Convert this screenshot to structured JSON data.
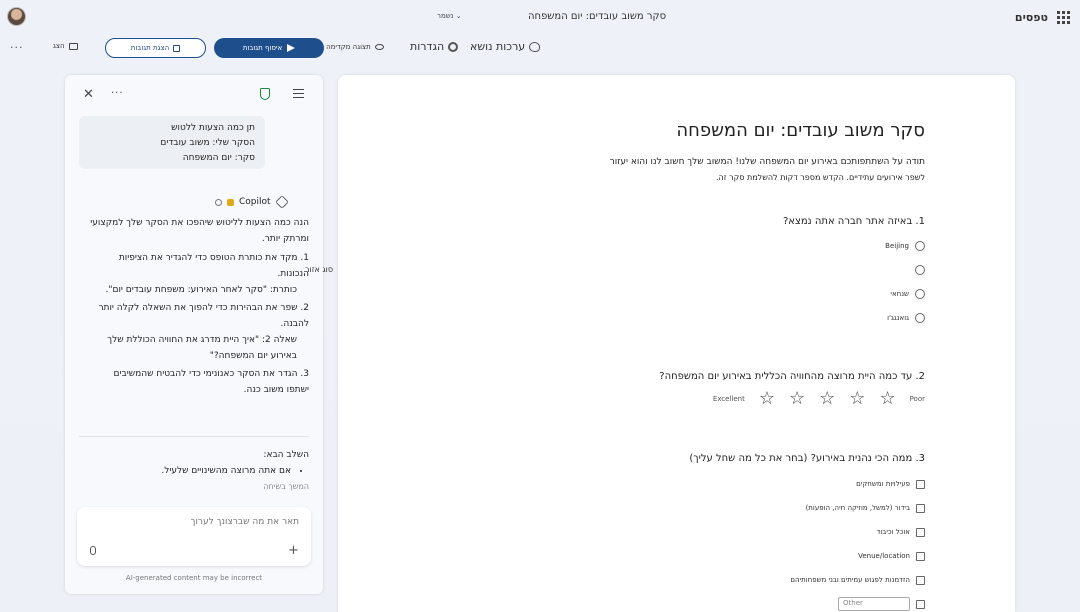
{
  "topbar": {
    "app_name": "טפסים",
    "doc_title": "סקר משוב עובדים: יום המשפחה",
    "save_state": "נשמר ⌄"
  },
  "toolbar": {
    "themes": "ערכות נושא",
    "settings": "הגדרות",
    "preview": "תצוגה מקדימה",
    "collect": "איסוף תגובות",
    "answers": "הצגת תגובות",
    "present": "הצג"
  },
  "copilot": {
    "user_prompt": [
      "תן כמה הצעות ללטוש",
      "הסקר שלי: משוב עובדים",
      "סקר: יום המשפחה"
    ],
    "name": "Copilot",
    "intro": "הנה כמה הצעות לליטוש שיהפכו את הסקר שלך למקצועי ומרתק יותר.",
    "items": [
      {
        "num": "1.",
        "text": "מקד את כותרת הטופס כדי להגדיר את הציפיות הנכונות.",
        "sub": "כותרת: \"סקר לאחר האירוע: משפחת עובדים יום\"."
      },
      {
        "num": "2.",
        "text": "שפר את הבהירות כדי להפוך את השאלה לקלה יותר להבנה.",
        "sub": "שאלה 2: \"איך היית מדרג את החוויה הכוללת שלך באירוע יום המשפחה?\""
      },
      {
        "num": "3.",
        "text": "הגדר את הסקר כאנונימי כדי להבטיח שהמשיבים ישתפו משוב כנה.",
        "sub": ""
      }
    ],
    "side_label": "סוג אזור",
    "next_heading": "השלב הבא:",
    "next_items": [
      "אם אתה מרוצה מהשינויים שלעיל."
    ],
    "next_fade": "המשך בשיחה",
    "compose_placeholder": "תאר את מה שברצונך לערוך",
    "disclaimer": "AI-generated content may be incorrect"
  },
  "form": {
    "title": "סקר משוב עובדים: יום המשפחה",
    "description_1": "תודה על השתתפותכם באירוע יום המשפחה שלנו! המשוב שלך חשוב לנו והוא יעזור",
    "description_2": "לשפר אירועים עתידיים. הקדש מספר דקות להשלמת סקר זה.",
    "q1": {
      "title": "1. באיזה אתר חברה אתה נמצא?",
      "options": [
        "Beijing",
        "",
        "שנחאי",
        "גואנגג'ו"
      ]
    },
    "q2": {
      "title": "2. עד כמה היית מרוצה מהחוויה הכללית באירוע יום המשפחה?",
      "low_label": "Poor",
      "high_label": "Excellent",
      "stars": 5
    },
    "q3": {
      "title": "3. ממה הכי נהנית באירוע? (בחר את כל מה שחל עליך)",
      "options": [
        "פעילויות ומשחקים",
        "בידור (למשל, מוזיקה חיה, הופעות)",
        "אוכל וכיבוד",
        "Venue/location",
        "הזדמנות לפגוש עמיתים ובני משפחותיהם"
      ],
      "other_placeholder": "Other"
    }
  }
}
